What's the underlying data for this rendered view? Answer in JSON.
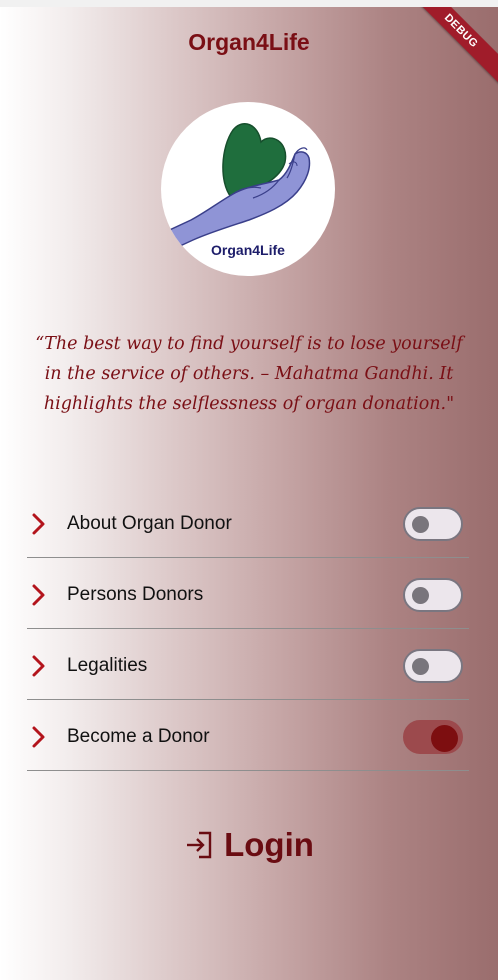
{
  "app": {
    "title": "Organ4Life",
    "debug_banner": "DEBUG",
    "logo_text": "Organ4Life"
  },
  "quote": {
    "text": "“The best way to find yourself is to lose yourself in the service of others. – Mahatma Gandhi. It highlights the selflessness of organ donation.\""
  },
  "menu": {
    "items": [
      {
        "label": "About Organ Donor",
        "toggle_on": false
      },
      {
        "label": "Persons Donors",
        "toggle_on": false
      },
      {
        "label": "Legalities",
        "toggle_on": false
      },
      {
        "label": "Become a Donor",
        "toggle_on": true
      }
    ]
  },
  "login": {
    "label": "Login",
    "icon": "login-icon"
  },
  "colors": {
    "accent": "#7a0f15",
    "toggle_on_track": "#9c4a4d",
    "toggle_on_knob": "#7d0e10",
    "debug_banner": "#a01c2a"
  }
}
